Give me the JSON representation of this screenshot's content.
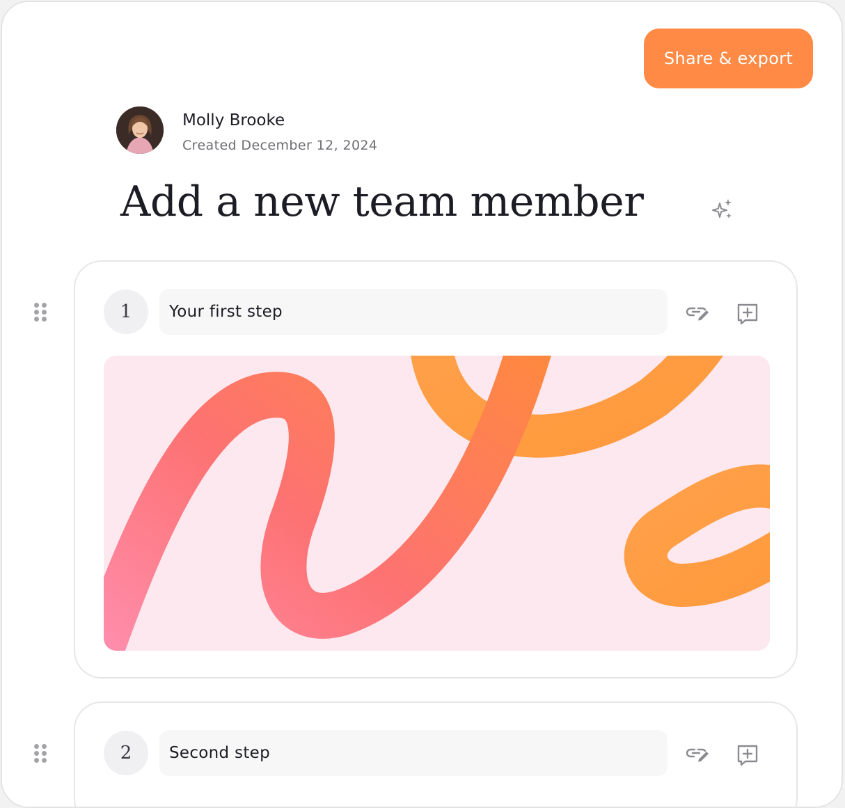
{
  "header": {
    "share_label": "Share & export"
  },
  "author": {
    "name": "Molly Brooke",
    "created": "Created December 12, 2024"
  },
  "page": {
    "title": "Add a new team member"
  },
  "steps": [
    {
      "number": "1",
      "title": "Your first step",
      "has_image": true
    },
    {
      "number": "2",
      "title": "Second step",
      "has_image": false
    }
  ],
  "icons": {
    "ai": "sparkle-icon",
    "link": "link-edit-icon",
    "add": "add-box-icon",
    "drag": "drag-handle-icon"
  },
  "colors": {
    "accent": "#ff8a45",
    "image_background": "#fde8ef",
    "ribbon_pink": "#fb7a8a",
    "ribbon_orange": "#ffa04a"
  }
}
